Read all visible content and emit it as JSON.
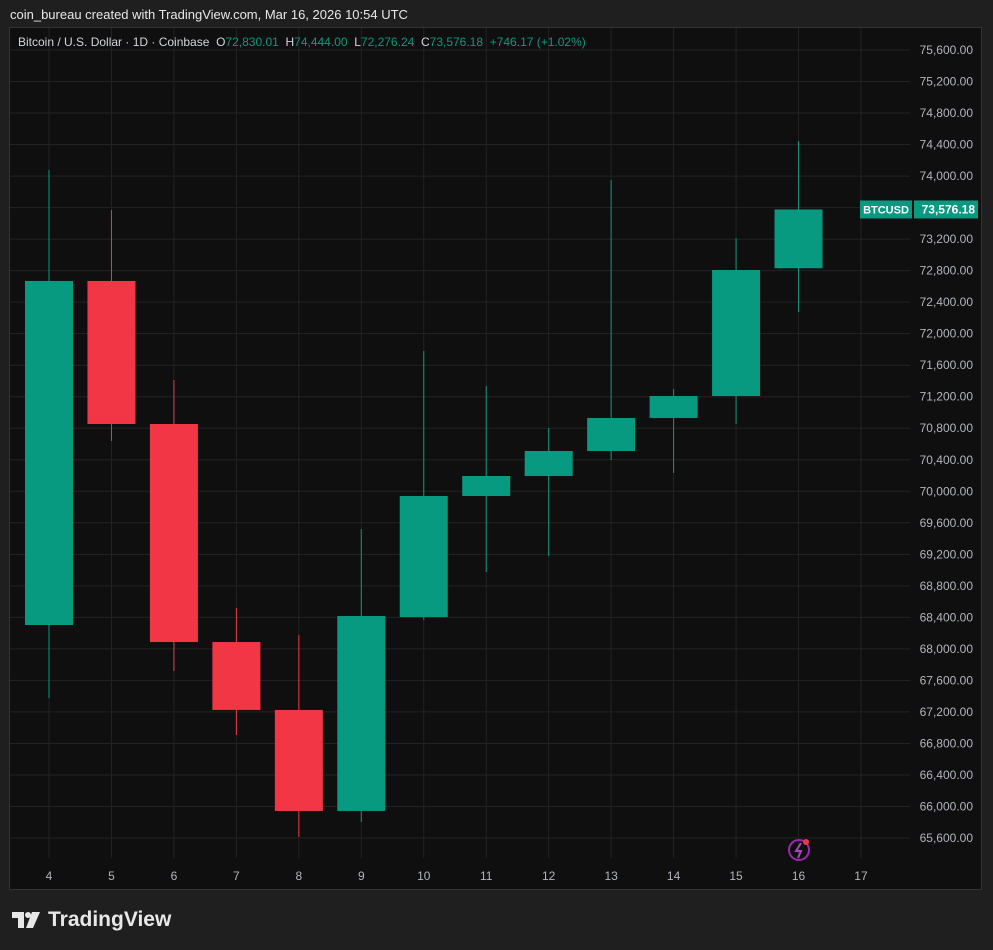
{
  "header": "coin_bureau created with TradingView.com, Mar 16, 2026 10:54 UTC",
  "legend": {
    "symbol": "Bitcoin / U.S. Dollar · 1D · Coinbase",
    "o_label": "O",
    "o": "72,830.01",
    "h_label": "H",
    "h": "74,444.00",
    "l_label": "L",
    "l": "72,276.24",
    "c_label": "C",
    "c": "73,576.18",
    "change": "+746.17 (+1.02%)"
  },
  "price_tag": {
    "symbol": "BTCUSD",
    "value": "73,576.18"
  },
  "brand": "TradingView",
  "colors": {
    "up": "#089981",
    "down": "#f23645"
  },
  "chart_data": {
    "type": "candlestick",
    "title": "Bitcoin / U.S. Dollar · 1D · Coinbase",
    "x": [
      4,
      5,
      6,
      7,
      8,
      9,
      10,
      11,
      12,
      13,
      14,
      15,
      16
    ],
    "x_ticks": [
      "4",
      "5",
      "6",
      "7",
      "8",
      "9",
      "10",
      "11",
      "12",
      "13",
      "14",
      "15",
      "16",
      "17"
    ],
    "ohlc": [
      [
        68303,
        74077,
        67377,
        72669
      ],
      [
        72669,
        73570,
        70638,
        70854
      ],
      [
        70854,
        71412,
        67719,
        68087
      ],
      [
        68087,
        68519,
        66907,
        67225
      ],
      [
        67225,
        68176,
        65613,
        65943
      ],
      [
        65943,
        69521,
        65803,
        68417
      ],
      [
        68404,
        71780,
        68367,
        69940
      ],
      [
        69940,
        71336,
        68976,
        70194
      ],
      [
        70194,
        70803,
        69179,
        70511
      ],
      [
        70511,
        73950,
        70397,
        70930
      ],
      [
        70930,
        71298,
        70232,
        71209
      ],
      [
        71209,
        73214,
        70854,
        72808
      ],
      [
        72830.01,
        74444.0,
        72276.24,
        73576.18
      ]
    ],
    "y_ticks": [
      "75,600.00",
      "75,200.00",
      "74,800.00",
      "74,400.00",
      "74,000.00",
      "73,600.00",
      "73,200.00",
      "72,800.00",
      "72,400.00",
      "72,000.00",
      "71,600.00",
      "71,200.00",
      "70,800.00",
      "70,400.00",
      "70,000.00",
      "69,600.00",
      "69,200.00",
      "68,800.00",
      "68,400.00",
      "68,000.00",
      "67,600.00",
      "67,200.00",
      "66,800.00",
      "66,400.00",
      "66,000.00",
      "65,600.00"
    ],
    "ylim": [
      65600,
      75600
    ],
    "grid": true
  }
}
